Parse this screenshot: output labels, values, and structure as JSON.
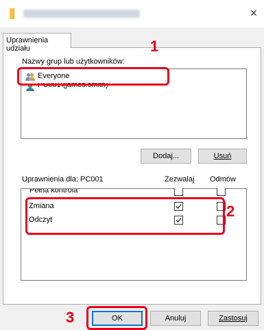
{
  "window": {
    "close_glyph": "×"
  },
  "tabs": [
    {
      "label": "Uprawnienia udziału"
    }
  ],
  "groups_label": "Nazwy grup lub użytkowników:",
  "users": [
    {
      "name": "Everyone",
      "icon": "users-group-icon"
    },
    {
      "name": "PC001\\(james.smith)",
      "icon": "user-icon"
    }
  ],
  "buttons": {
    "add": "Dodaj...",
    "remove": "Usuń",
    "ok": "OK",
    "cancel": "Anuluj",
    "apply": "Zastosuj"
  },
  "permissions": {
    "header": "Uprawnienia dla: PC001",
    "allow_label": "Zezwalaj",
    "deny_label": "Odmów",
    "rows": [
      {
        "name": "Pełna kontrola",
        "allow": false,
        "deny": false
      },
      {
        "name": "Zmiana",
        "allow": true,
        "deny": false
      },
      {
        "name": "Odczyt",
        "allow": true,
        "deny": false
      }
    ]
  },
  "annotations": {
    "step1": "1",
    "step2": "2",
    "step3": "3",
    "highlight_color": "#e8001c"
  },
  "colors": {
    "dialog_bg": "#f0f0f0",
    "accent": "#0078d7",
    "folder": "#f5c542"
  }
}
